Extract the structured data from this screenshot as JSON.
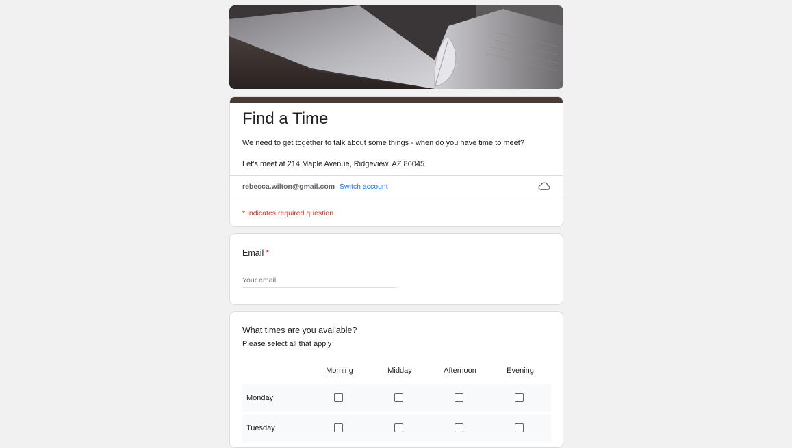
{
  "form": {
    "title": "Find a Time",
    "description": "We need to get together to talk about some things - when do you have time to meet?",
    "location": "Let's meet at 214 Maple Avenue, Ridgeview, AZ 86045",
    "account_email": "rebecca.wilton@gmail.com",
    "switch_account_label": "Switch account",
    "required_note": "* Indicates required question",
    "accent_color": "#4a3a36",
    "link_color": "#1a73e8",
    "required_color": "#d93025",
    "cloud_icon": "cloud-saved-icon"
  },
  "email_question": {
    "label": "Email",
    "required_mark": "*",
    "placeholder": "Your email"
  },
  "grid_question": {
    "title": "What times are you available?",
    "subtitle": "Please select all that apply",
    "columns": [
      "Morning",
      "Midday",
      "Afternoon",
      "Evening"
    ],
    "rows": [
      "Monday",
      "Tuesday"
    ]
  }
}
